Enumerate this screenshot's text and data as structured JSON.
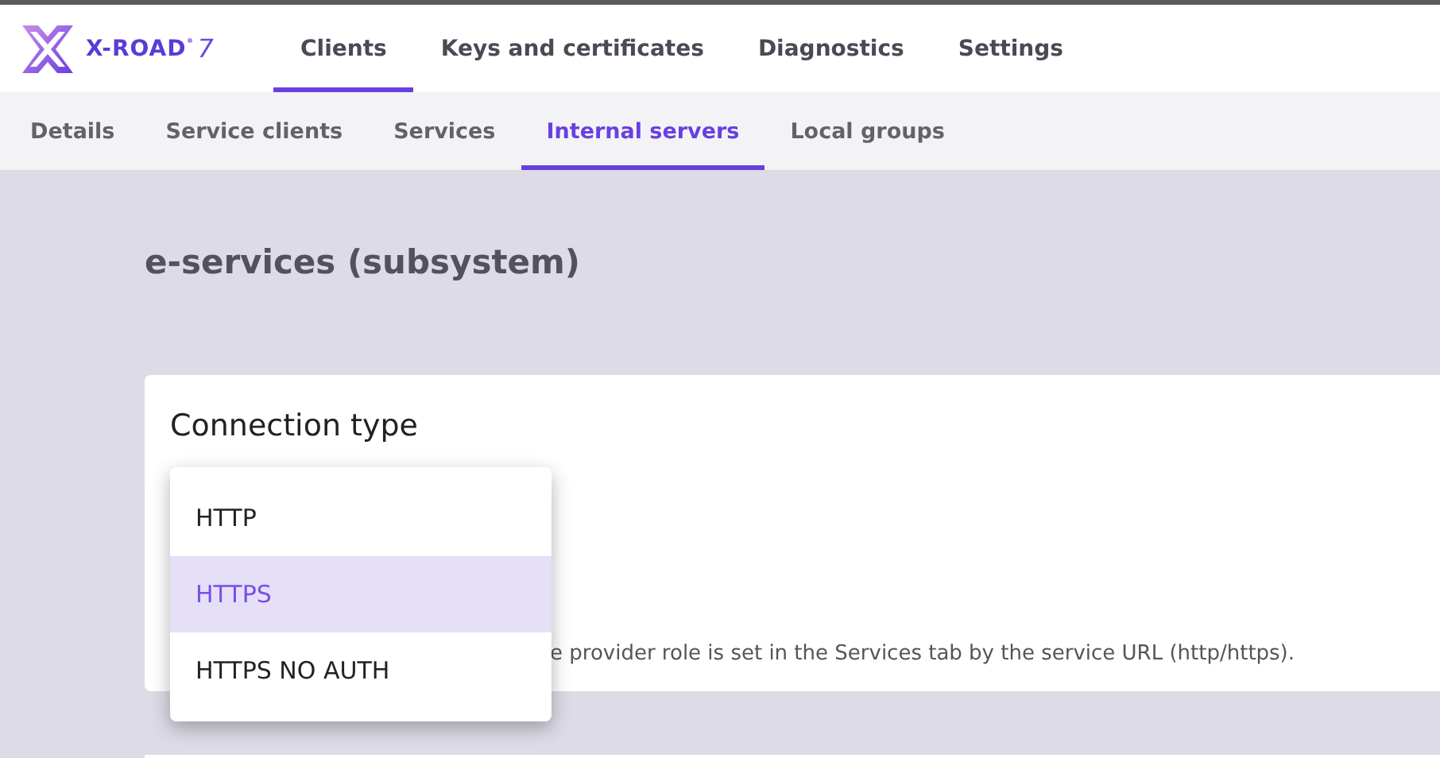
{
  "logo": {
    "name": "X-ROAD",
    "version": "7"
  },
  "main_tabs": [
    {
      "label": "Clients",
      "selected": true
    },
    {
      "label": "Keys and certificates",
      "selected": false
    },
    {
      "label": "Diagnostics",
      "selected": false
    },
    {
      "label": "Settings",
      "selected": false
    }
  ],
  "sub_tabs": [
    {
      "label": "Details",
      "selected": false
    },
    {
      "label": "Service clients",
      "selected": false
    },
    {
      "label": "Services",
      "selected": false
    },
    {
      "label": "Internal servers",
      "selected": true
    },
    {
      "label": "Local groups",
      "selected": false
    }
  ],
  "page_title": "e-services (subsystem)",
  "connection_card": {
    "title": "Connection type",
    "help_text": "e provider role is set in the Services tab by the service URL (http/https)."
  },
  "dropdown_options": [
    {
      "label": "HTTP",
      "selected": false
    },
    {
      "label": "HTTPS",
      "selected": true
    },
    {
      "label": "HTTPS NO AUTH",
      "selected": false
    }
  ]
}
